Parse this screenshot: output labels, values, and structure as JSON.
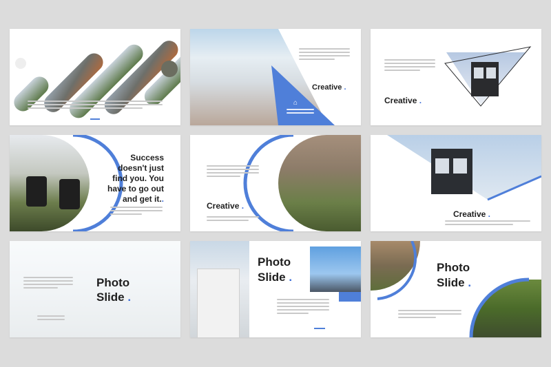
{
  "slides": [
    {
      "id": 1
    },
    {
      "id": 2,
      "title": "Creative",
      "dot": "."
    },
    {
      "id": 3,
      "title": "Creative",
      "dot": "."
    },
    {
      "id": 4,
      "quote_lines": [
        "Success",
        "doesn't just",
        "find you. You",
        "have to go out",
        "and get it."
      ],
      "quote_dot": "."
    },
    {
      "id": 5,
      "title": "Creative",
      "dot": "."
    },
    {
      "id": 6,
      "title": "Creative",
      "dot": "."
    },
    {
      "id": 7,
      "title_line1": "Photo",
      "title_line2": "Slide",
      "dot": "."
    },
    {
      "id": 8,
      "title_line1": "Photo",
      "title_line2": "Slide",
      "dot": "."
    },
    {
      "id": 9,
      "title_line1": "Photo",
      "title_line2": "Slide",
      "dot": "."
    }
  ],
  "colors": {
    "accent": "#4f7fd9",
    "background": "#dcdcdc",
    "slide": "#ffffff",
    "text": "#1f1f1f"
  },
  "icons": {
    "home": "home-icon"
  }
}
